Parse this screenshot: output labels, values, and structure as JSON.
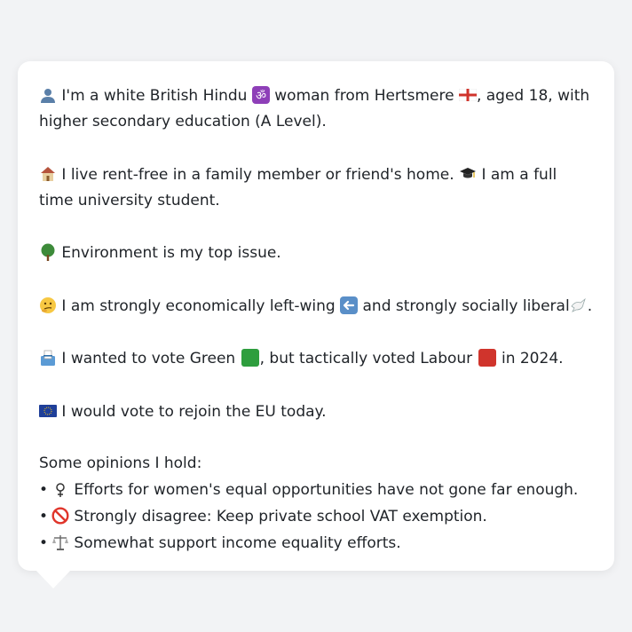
{
  "profile": {
    "identity": {
      "icon": "person-silhouette-icon",
      "text_1": "I'm a white British Hindu",
      "icon_2": "om-icon",
      "text_2": "woman from Hertsmere",
      "icon_3": "england-flag-icon",
      "text_3": ", aged 18, with higher secondary education (A Level)."
    },
    "housing": {
      "icon": "house-icon",
      "text_1": "I live rent-free in a family member or friend's home.",
      "icon_2": "graduation-cap-icon",
      "text_2": "I am a full time university student."
    },
    "issue": {
      "icon": "tree-icon",
      "text": "Environment is my top issue."
    },
    "ideology": {
      "icon": "thinking-face-icon",
      "text_1": "I am strongly economically left-wing",
      "icon_2": "left-arrow-icon",
      "text_2": "and strongly socially liberal",
      "icon_3": "dove-icon",
      "text_3": "."
    },
    "vote": {
      "icon": "ballot-box-icon",
      "text_1": "I wanted to vote Green",
      "green_color": "#2e9e3e",
      "text_2": ", but tactically voted Labour",
      "red_color": "#d0342c",
      "text_3": "in 2024."
    },
    "eu": {
      "icon": "eu-flag-icon",
      "text": "I would vote to rejoin the EU today."
    },
    "opinions": {
      "heading": "Some opinions I hold:",
      "items": [
        {
          "icon": "female-sign-icon",
          "text": "Efforts for women's equal opportunities have not gone far enough."
        },
        {
          "icon": "no-entry-icon",
          "text": "Strongly disagree: Keep private school VAT exemption."
        },
        {
          "icon": "balance-scale-icon",
          "text": "Somewhat support income equality efforts."
        }
      ]
    }
  }
}
